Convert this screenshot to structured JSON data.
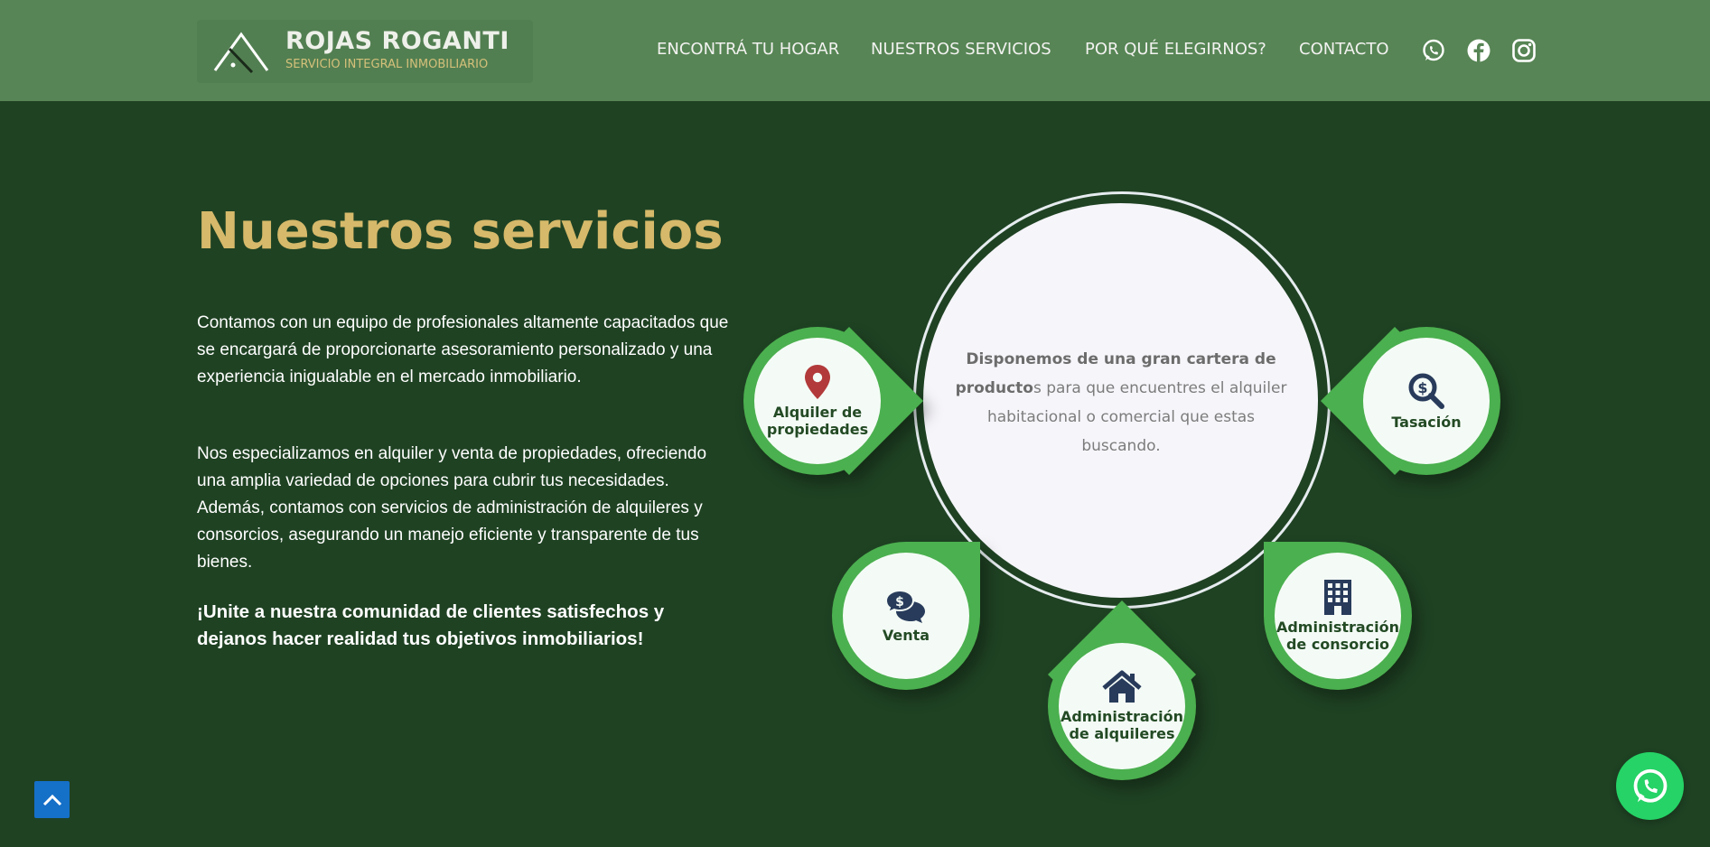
{
  "colors": {
    "header_bg": "#578555",
    "page_bg": "#1f4223",
    "title_gold": "#d6b96a",
    "pin_green": "#4bb04f",
    "scroll_top_blue": "#1570c8",
    "whatsapp_green": "#25d366",
    "icon_red": "#b23a3a",
    "icon_navy": "#283b5b"
  },
  "header": {
    "logo": {
      "title": "ROJAS ROGANTI",
      "subtitle": "SERVICIO INTEGRAL INMOBILIARIO",
      "icon": "house-roof-logo-icon"
    },
    "nav": [
      {
        "label": "ENCONTRÁ TU HOGAR"
      },
      {
        "label": "NUESTROS SERVICIOS"
      },
      {
        "label": "POR QUÉ ELEGIRNOS?"
      },
      {
        "label": "CONTACTO"
      }
    ],
    "social": [
      {
        "icon": "whatsapp-icon"
      },
      {
        "icon": "facebook-icon"
      },
      {
        "icon": "instagram-icon"
      }
    ]
  },
  "main": {
    "title": "Nuestros servicios",
    "paragraphs": [
      "Contamos con un equipo de profesionales altamente capacitados que se encargará de proporcionarte asesoramiento personalizado y una experiencia inigualable en el mercado inmobiliario.",
      "Nos especializamos en alquiler y venta de propiedades, ofreciendo una amplia variedad de opciones para cubrir tus necesidades. Además, contamos con servicios de administración de alquileres y consorcios, asegurando un manejo eficiente y transparente de tus bienes.",
      "¡Unite a nuestra comunidad de clientes satisfechos y dejanos hacer realidad tus objetivos inmobiliarios!"
    ]
  },
  "services": {
    "center": {
      "bold": "Disponemos de una gran cartera de producto",
      "rest": "s para que encuentres el alquiler habitacional o comercial que estas buscando."
    },
    "items": [
      {
        "label_line1": "Alquiler de",
        "label_line2": "propiedades",
        "icon": "map-marker-icon"
      },
      {
        "label_line1": "Tasación",
        "label_line2": "",
        "icon": "dollar-search-icon"
      },
      {
        "label_line1": "Venta",
        "label_line2": "",
        "icon": "dollar-chat-icon"
      },
      {
        "label_line1": "Administración",
        "label_line2": "de alquileres",
        "icon": "house-icon"
      },
      {
        "label_line1": "Administración",
        "label_line2": "de consorcio",
        "icon": "building-icon"
      }
    ]
  },
  "floating": {
    "scroll_top_icon": "chevron-up-icon",
    "whatsapp_icon": "whatsapp-icon"
  }
}
